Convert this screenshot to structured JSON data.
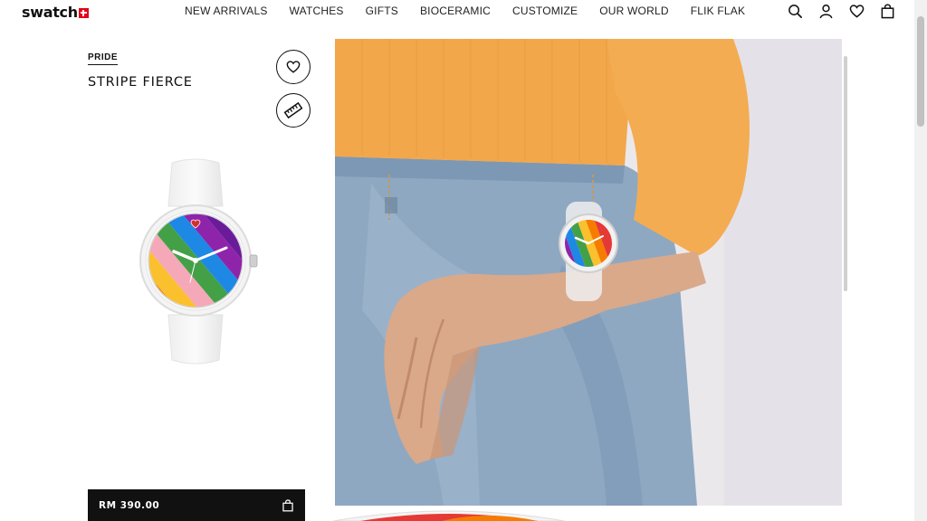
{
  "brand": {
    "logo_text": "swatch"
  },
  "nav": {
    "items": [
      {
        "label": "NEW ARRIVALS"
      },
      {
        "label": "WATCHES"
      },
      {
        "label": "GIFTS"
      },
      {
        "label": "BIOCERAMIC"
      },
      {
        "label": "CUSTOMIZE"
      },
      {
        "label": "OUR WORLD"
      },
      {
        "label": "FLIK FLAK"
      }
    ]
  },
  "header_icons": [
    "search-icon",
    "account-icon",
    "wishlist-icon",
    "bag-icon"
  ],
  "product": {
    "collection": "PRIDE",
    "name": "STRIPE FIERCE",
    "price": "RM 390.00"
  },
  "colors": {
    "brand_red": "#e2001a",
    "button_black": "#111111",
    "sweater_orange": "#f2a74a",
    "denim_blue": "#8fa9c4"
  }
}
